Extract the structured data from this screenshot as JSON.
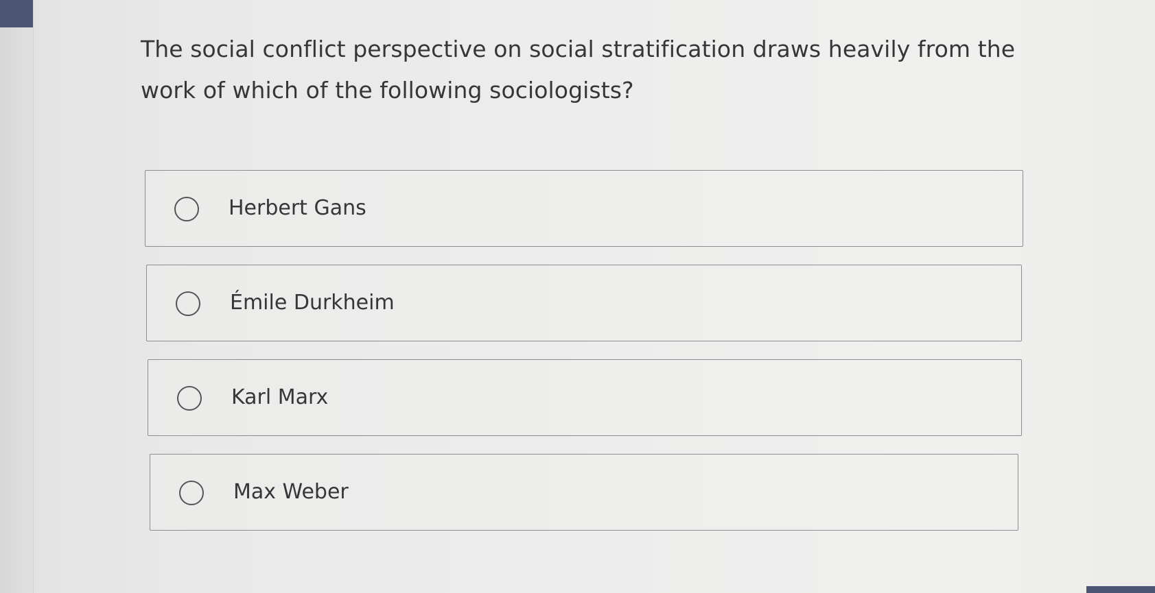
{
  "question": {
    "text": "The social conflict perspective on social stratification draws heavily from the work of which of the following sociologists?"
  },
  "options": [
    {
      "label": "Herbert Gans",
      "selected": false
    },
    {
      "label": "Émile Durkheim",
      "selected": false
    },
    {
      "label": "Karl Marx",
      "selected": false
    },
    {
      "label": "Max Weber",
      "selected": false
    }
  ],
  "icons": {
    "radio": "radio-empty-icon"
  },
  "colors": {
    "accent": "#4d5574",
    "border": "#8d8d8d",
    "text": "#363636"
  }
}
